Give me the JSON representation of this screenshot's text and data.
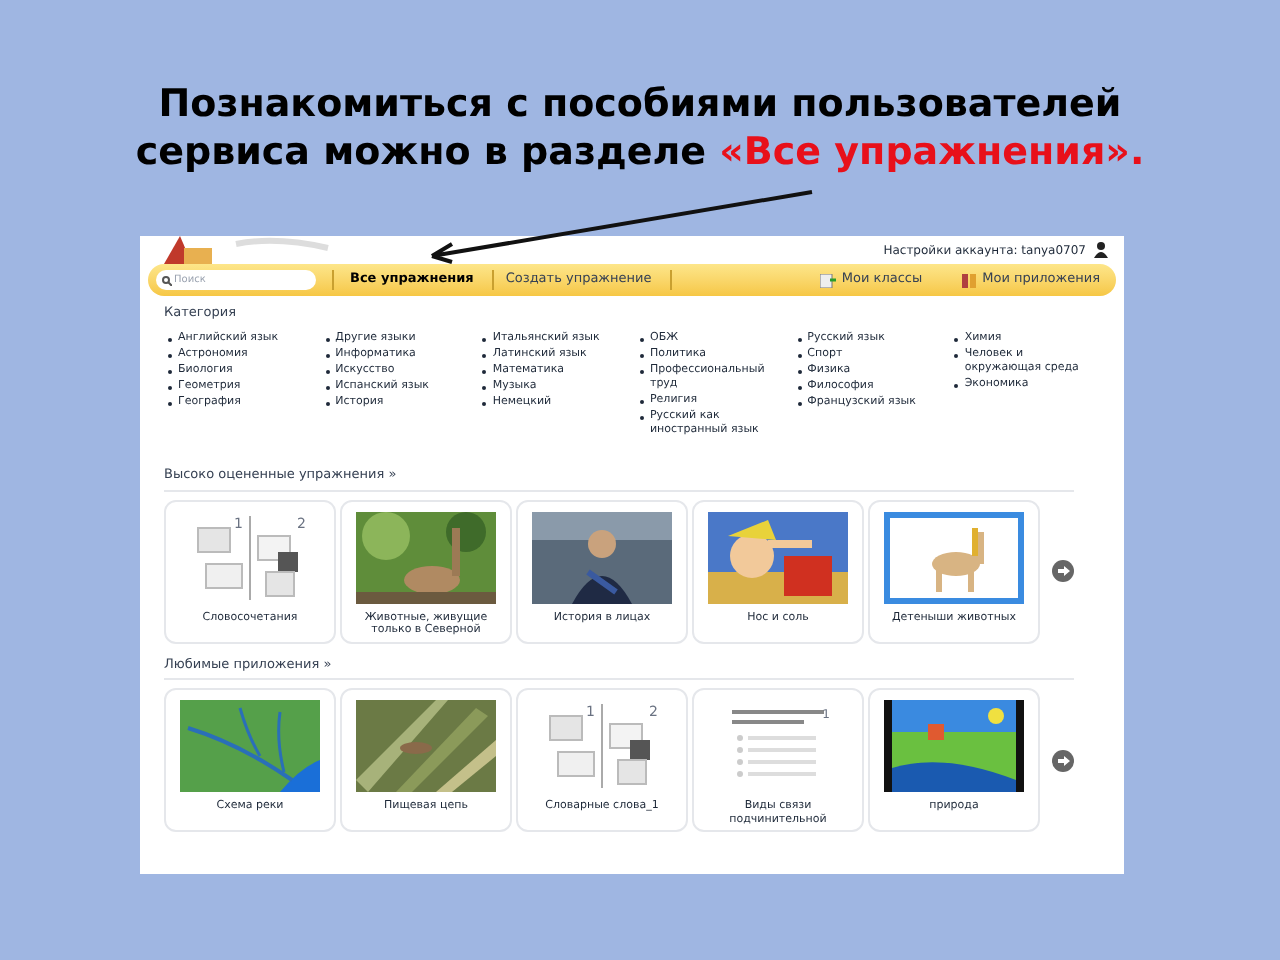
{
  "slide": {
    "title": "Познакомиться с пособиями пользователей сервиса можно в разделе **«Все упражнения».**"
  },
  "site": {
    "account": "Настройки аккаунта: tanya0707",
    "search": {
      "placeholder": "Поиск"
    },
    "nav": [
      {
        "label": "Все упражнения",
        "selected": true,
        "kind": "link"
      },
      {
        "label": "Создать упражнение",
        "selected": false,
        "kind": "link"
      },
      {
        "label": "Мои классы",
        "selected": false,
        "kind": "classes"
      },
      {
        "label": "Мои приложения",
        "selected": false,
        "kind": "apps"
      }
    ],
    "categories_title": "Категория",
    "categories": [
      [
        "Английский язык",
        "Астрономия",
        "Биология",
        "Геометрия",
        "География"
      ],
      [
        "Другие языки",
        "Информатика",
        "Искусство",
        "Испанский язык",
        "История"
      ],
      [
        "Итальянский язык",
        "Латинский язык",
        "Математика",
        "Музыка",
        "Немецкий"
      ],
      [
        "ОБЖ",
        "Политика",
        "Профессиональный труд",
        "Религия",
        "Русский как иностранный язык"
      ],
      [
        "Русский язык",
        "Спорт",
        "Физика",
        "Философия",
        "Французский язык"
      ],
      [
        "Химия",
        "Человек и окружающая среда",
        "Экономика"
      ]
    ],
    "sections": [
      {
        "title": "Высоко оцененные упражнения »",
        "cards": [
          {
            "label": "Словосочетания",
            "kind": "template",
            "numbers": [
              "1",
              "2"
            ]
          },
          {
            "label": "Животные, живущие только в Северной",
            "kind": "picture"
          },
          {
            "label": "История в лицах",
            "kind": "picture"
          },
          {
            "label": "Нос и соль",
            "kind": "picture"
          },
          {
            "label": "Детеныши животных",
            "kind": "picture"
          }
        ]
      },
      {
        "title": "Любимые приложения »",
        "cards": [
          {
            "label": "Схема реки",
            "kind": "picture"
          },
          {
            "label": "Пищевая цепь",
            "kind": "picture"
          },
          {
            "label": "Словарные слова_1",
            "kind": "template",
            "numbers": [
              "1",
              "2"
            ]
          },
          {
            "label": "Виды связи подчинительной",
            "kind": "list",
            "numbers": [
              "1"
            ]
          },
          {
            "label": "природа",
            "kind": "picture"
          }
        ]
      }
    ]
  }
}
